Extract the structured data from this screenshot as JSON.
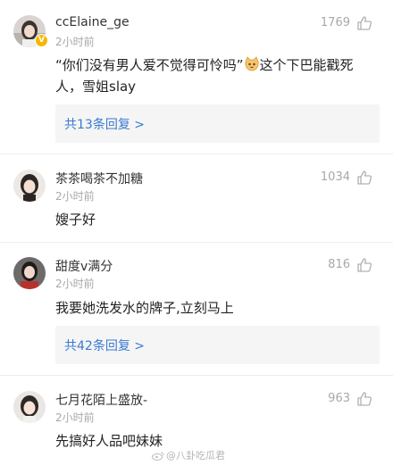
{
  "comments": [
    {
      "username": "ccElaine_ge",
      "time": "2小时前",
      "likes": "1769",
      "verified_badge": "V",
      "text_part1": "“你们没有男人爱不觉得可怜吗”",
      "emoji": "cat-emoji",
      "text_part2": "这个下巴能戳死人，雪姐slay",
      "replies": "共13条回复 >"
    },
    {
      "username": "茶茶喝茶不加糖",
      "time": "2小时前",
      "likes": "1034",
      "text": "嫂子好"
    },
    {
      "username": "甜度v满分",
      "time": "2小时前",
      "likes": "816",
      "text": "我要她洗发水的牌子,立刻马上",
      "replies": "共42条回复 >"
    },
    {
      "username": "七月花陌上盛放-",
      "time": "2小时前",
      "likes": "963",
      "text": "先搞好人品吧妹妹"
    }
  ],
  "watermark": "@八卦吃瓜君",
  "colors": {
    "link": "#3a7ad1",
    "muted": "#a8a8a8",
    "reply_bg": "#f5f5f5",
    "badge": "#f5b800"
  }
}
